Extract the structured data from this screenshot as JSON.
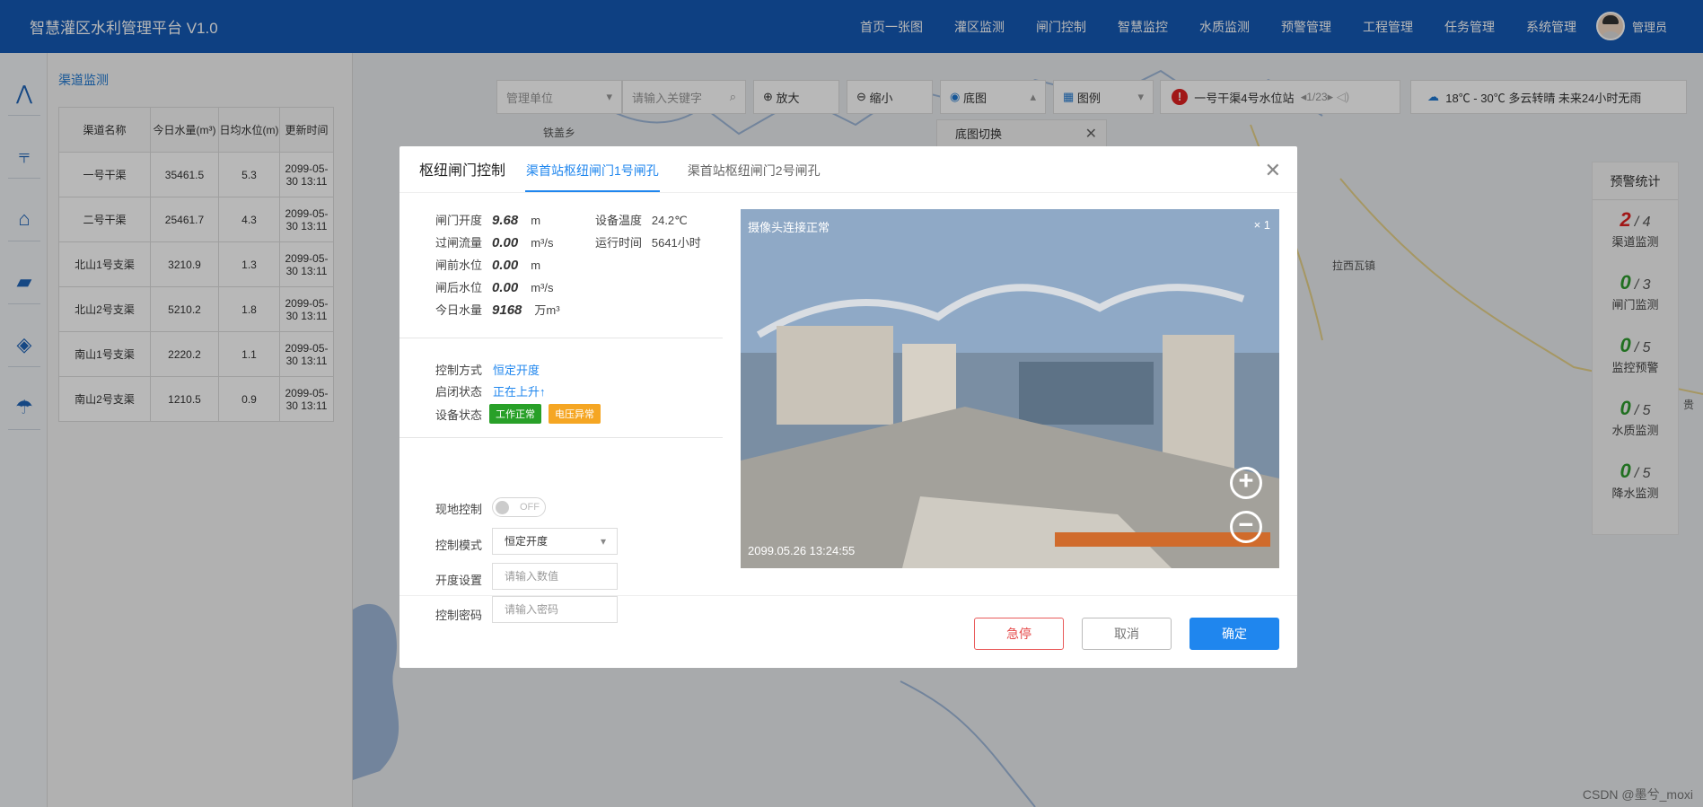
{
  "header": {
    "title": "智慧灌区水利管理平台 V1.0",
    "nav": [
      "首页一张图",
      "灌区监测",
      "闸门控制",
      "智慧监控",
      "水质监测",
      "预警管理",
      "工程管理",
      "任务管理",
      "系统管理"
    ],
    "user": "管理员"
  },
  "sidebar": {
    "icons": [
      "channel-icon",
      "pump-station-icon",
      "gate-icon",
      "camera-icon",
      "water-quality-icon",
      "rainfall-icon"
    ]
  },
  "channel_panel": {
    "title": "渠道监测",
    "headers": [
      "渠道名称",
      "今日水量(m³)",
      "日均水位(m)",
      "更新时间"
    ],
    "rows": [
      [
        "一号干渠",
        "35461.5",
        "5.3",
        "2099-05-30 13:11"
      ],
      [
        "二号干渠",
        "25461.7",
        "4.3",
        "2099-05-30 13:11"
      ],
      [
        "北山1号支渠",
        "3210.9",
        "1.3",
        "2099-05-30 13:11"
      ],
      [
        "北山2号支渠",
        "5210.2",
        "1.8",
        "2099-05-30 13:11"
      ],
      [
        "南山1号支渠",
        "2220.2",
        "1.1",
        "2099-05-30 13:11"
      ],
      [
        "南山2号支渠",
        "1210.5",
        "0.9",
        "2099-05-30 13:11"
      ]
    ]
  },
  "map_toolbar": {
    "unit_select": "管理单位",
    "keyword_placeholder": "请输入关键字",
    "zoom_in": "放大",
    "zoom_out": "缩小",
    "basemap": "底图",
    "legend": "图例",
    "warning_text": "一号干渠4号水位站",
    "warning_page": "1/23",
    "weather": "18℃ - 30℃ 多云转晴 未来24小时无雨",
    "basemap_switch": "底图切换"
  },
  "map_labels": [
    "铁盖乡",
    "拉西瓦镇",
    "贵"
  ],
  "stats": {
    "title": "预警统计",
    "items": [
      {
        "value": "2",
        "total": "4",
        "label": "渠道监测",
        "color": "#e02020"
      },
      {
        "value": "0",
        "total": "3",
        "label": "闸门监测",
        "color": "#2e9b2e"
      },
      {
        "value": "0",
        "total": "5",
        "label": "监控预警",
        "color": "#2e9b2e"
      },
      {
        "value": "0",
        "total": "5",
        "label": "水质监测",
        "color": "#2e9b2e"
      },
      {
        "value": "0",
        "total": "5",
        "label": "降水监测",
        "color": "#2e9b2e"
      }
    ]
  },
  "modal": {
    "title": "枢纽闸门控制",
    "tabs": [
      "渠首站枢纽闸门1号闸孔",
      "渠首站枢纽闸门2号闸孔"
    ],
    "metrics": [
      {
        "label": "闸门开度",
        "value": "9.68",
        "unit": "m"
      },
      {
        "label": "过闸流量",
        "value": "0.00",
        "unit": "m³/s"
      },
      {
        "label": "闸前水位",
        "value": "0.00",
        "unit": "m"
      },
      {
        "label": "闸后水位",
        "value": "0.00",
        "unit": "m³/s"
      },
      {
        "label": "今日水量",
        "value": "9168",
        "unit": "万m³"
      }
    ],
    "device_temp_label": "设备温度",
    "device_temp": "24.2℃",
    "runtime_label": "运行时间",
    "runtime": "5641小时",
    "control_mode_label": "控制方式",
    "control_mode": "恒定开度",
    "open_status_label": "启闭状态",
    "open_status": "正在上升↑",
    "device_status_label": "设备状态",
    "badges": [
      "工作正常",
      "电压异常"
    ],
    "local_control_label": "现地控制",
    "switch_text": "OFF",
    "mode_label": "控制模式",
    "mode_value": "恒定开度",
    "opening_label": "开度设置",
    "opening_placeholder": "请输入数值",
    "password_label": "控制密码",
    "password_placeholder": "请输入密码",
    "camera_status": "摄像头连接正常",
    "camera_zoom": "× 1",
    "camera_time": "2099.05.26 13:24:55",
    "buttons": {
      "stop": "急停",
      "cancel": "取消",
      "ok": "确定"
    }
  },
  "watermark": "CSDN @墨兮_moxi"
}
